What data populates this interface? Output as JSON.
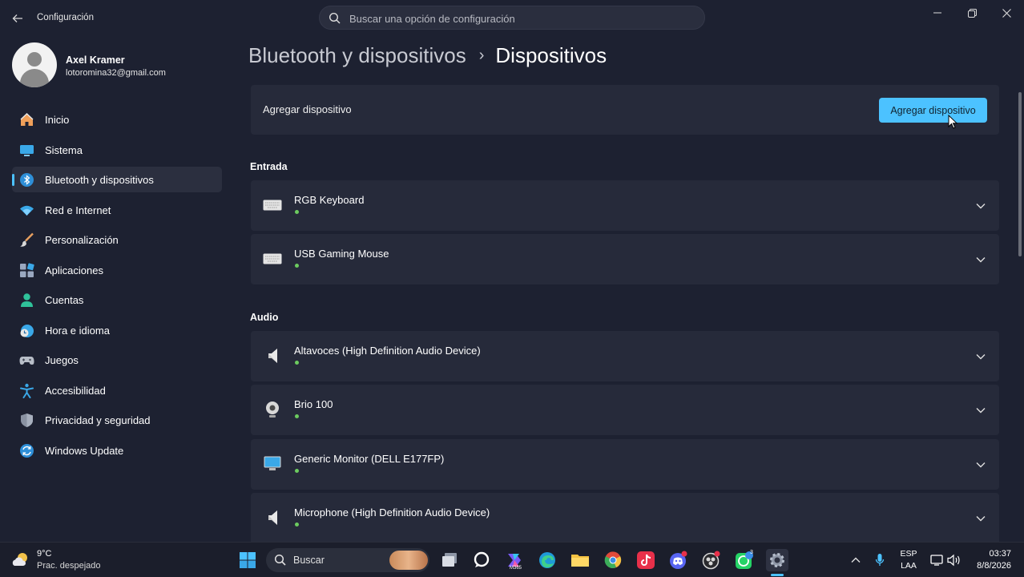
{
  "titlebar": {
    "app_title": "Configuración",
    "search_placeholder": "Buscar una opción de configuración",
    "controls": [
      "minimize-icon",
      "restore-icon",
      "close-icon"
    ]
  },
  "profile": {
    "name": "Axel Kramer",
    "email": "lotoromina32@gmail.com"
  },
  "sidebar": {
    "items": [
      {
        "label": "Inicio",
        "icon": "home-icon"
      },
      {
        "label": "Sistema",
        "icon": "monitor-icon"
      },
      {
        "label": "Bluetooth y dispositivos",
        "icon": "bluetooth-icon",
        "active": true
      },
      {
        "label": "Red e Internet",
        "icon": "wifi-icon"
      },
      {
        "label": "Personalización",
        "icon": "brush-icon"
      },
      {
        "label": "Aplicaciones",
        "icon": "apps-icon"
      },
      {
        "label": "Cuentas",
        "icon": "person-icon"
      },
      {
        "label": "Hora e idioma",
        "icon": "clock-globe-icon"
      },
      {
        "label": "Juegos",
        "icon": "gamepad-icon"
      },
      {
        "label": "Accesibilidad",
        "icon": "accessibility-icon"
      },
      {
        "label": "Privacidad y seguridad",
        "icon": "shield-icon"
      },
      {
        "label": "Windows Update",
        "icon": "update-icon"
      }
    ]
  },
  "breadcrumb": {
    "parent": "Bluetooth y dispositivos",
    "separator": "›",
    "current": "Dispositivos"
  },
  "add_device": {
    "label": "Agregar dispositivo",
    "button": "Agregar dispositivo"
  },
  "sections": {
    "input_title": "Entrada",
    "audio_title": "Audio"
  },
  "devices": {
    "input": [
      {
        "name": "RGB Keyboard",
        "icon": "keyboard-icon",
        "status": "connected"
      },
      {
        "name": "USB Gaming Mouse",
        "icon": "keyboard-icon",
        "status": "connected"
      }
    ],
    "audio": [
      {
        "name": "Altavoces (High Definition Audio Device)",
        "icon": "speaker-icon",
        "status": "connected"
      },
      {
        "name": "Brio 100",
        "icon": "webcam-icon",
        "status": "connected"
      },
      {
        "name": "Generic Monitor (DELL E177FP)",
        "icon": "monitor-icon",
        "status": "connected"
      },
      {
        "name": "Microphone (High Definition Audio Device)",
        "icon": "speaker-icon",
        "status": "connected"
      }
    ]
  },
  "taskbar": {
    "weather_temp": "9°C",
    "weather_desc": "Prac. despejado",
    "search_label": "Buscar",
    "lang_line1": "ESP",
    "lang_line2": "LAA",
    "time": "03:37",
    "date": "8/8/2026",
    "m365_label": "M365",
    "whatsapp_badge": "3"
  },
  "colors": {
    "accent": "#4cc2ff",
    "background": "#1d2131",
    "card": "#262a3a",
    "status_green": "#6ccb5f"
  }
}
